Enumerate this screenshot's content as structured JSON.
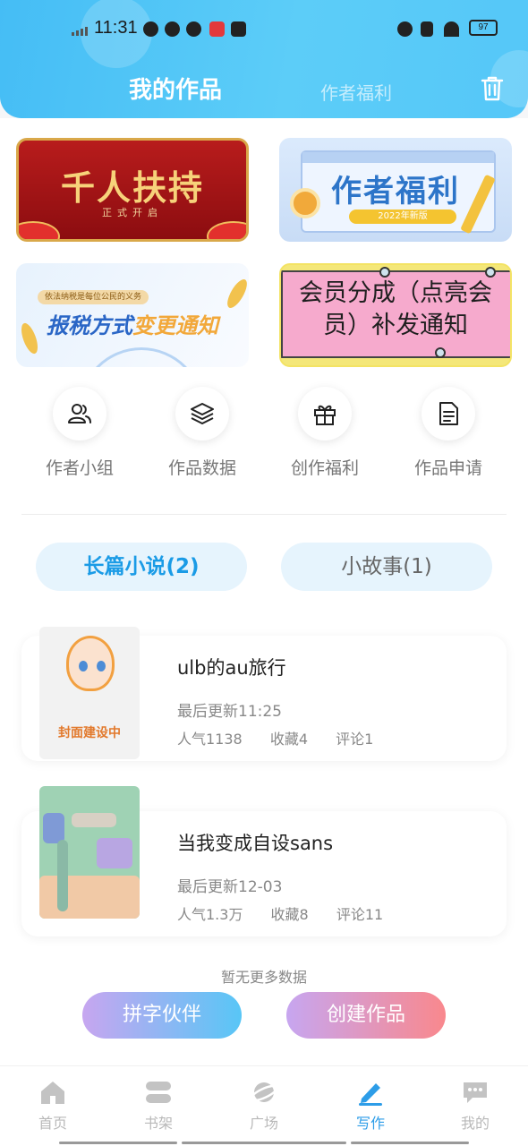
{
  "status_bar": {
    "time": "11:31",
    "battery": "97"
  },
  "header": {
    "title_active": "我的作品",
    "title_other": "作者福利"
  },
  "banners": {
    "b1_title": "千人扶持",
    "b1_sub": "正式开启",
    "b2_title": "作者福利",
    "b2_sub": "2022年新版",
    "b3_tag": "依法纳税是每位公民的义务",
    "b3_title_a": "报税方式",
    "b3_title_b": "变更通知",
    "b4_line1": "会员分成（点亮会",
    "b4_line2": "员）补发通知"
  },
  "quick_actions": [
    {
      "label": "作者小组",
      "icon": "users-icon"
    },
    {
      "label": "作品数据",
      "icon": "layers-icon"
    },
    {
      "label": "创作福利",
      "icon": "gift-icon"
    },
    {
      "label": "作品申请",
      "icon": "document-icon"
    }
  ],
  "categories": [
    {
      "label": "长篇小说(2)",
      "active": true
    },
    {
      "label": "小故事(1)",
      "active": false
    }
  ],
  "works": [
    {
      "title": "ulb的au旅行",
      "updated": "最后更新11:25",
      "popularity": "人气1138",
      "favorites": "收藏4",
      "comments": "评论1",
      "cover_text": "封面建设中"
    },
    {
      "title": "当我变成自设sans",
      "updated": "最后更新12-03",
      "popularity": "人气1.3万",
      "favorites": "收藏8",
      "comments": "评论11"
    }
  ],
  "no_more": "暂无更多数据",
  "actions": {
    "partner": "拼字伙伴",
    "create": "创建作品"
  },
  "tabbar": [
    {
      "label": "首页",
      "icon": "home-icon",
      "active": false
    },
    {
      "label": "书架",
      "icon": "bookshelf-icon",
      "active": false
    },
    {
      "label": "广场",
      "icon": "planet-icon",
      "active": false
    },
    {
      "label": "写作",
      "icon": "pen-icon",
      "active": true
    },
    {
      "label": "我的",
      "icon": "chat-icon",
      "active": false
    }
  ],
  "colors": {
    "accent": "#2d9de8",
    "header": "#4fc4f7"
  }
}
